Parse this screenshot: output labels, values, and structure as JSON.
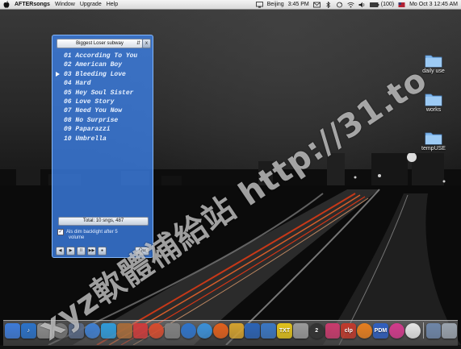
{
  "menubar": {
    "app_name": "AFTERsongs",
    "menus": [
      "Window",
      "Upgrade",
      "Help"
    ],
    "location": "Beijing",
    "clock": "3:45 PM",
    "battery": "(100)",
    "datetime": "Mo Oct 3 12:45 AM"
  },
  "desktop": {
    "icons": [
      {
        "label": "daily use"
      },
      {
        "label": "works"
      },
      {
        "label": "tempUSE"
      }
    ]
  },
  "widget": {
    "playlist_selector": "Biggest Loser subway",
    "close_label": "x",
    "songs": [
      "01 According To You",
      "02 American Boy",
      "03 Bleeding Love",
      "04 Hard",
      "05 Hey Soul Sister",
      "06 Love Story",
      "07 Need You Now",
      "08 No Surprise",
      "09 Paparazzi",
      "10 Umbrella"
    ],
    "total": "Total: 10 sngs, 487",
    "backlight_label": "Als dim backlight after 5",
    "volume_label": "volume",
    "quit_label": "Qu",
    "controls": [
      "◀",
      "▶",
      "II",
      "▶▶",
      "●"
    ]
  },
  "watermark": {
    "text": "xyz軟體補給站 http://31.to"
  },
  "dock": {
    "items": [
      {
        "name": "finder-icon",
        "label": "",
        "color": "#3d7bd8"
      },
      {
        "name": "itunes-icon",
        "label": "♪",
        "color": "#2b72c8"
      },
      {
        "name": "network-icon",
        "label": "",
        "color": "#8a8a8a"
      },
      {
        "name": "compass-icon",
        "label": "",
        "color": "#777777"
      },
      {
        "name": "settings-icon",
        "label": "",
        "color": "#5a6a86"
      },
      {
        "name": "ball-icon",
        "label": "",
        "color": "#3f7fd0"
      },
      {
        "name": "people-icon",
        "label": "",
        "color": "#2f9ad8"
      },
      {
        "name": "photo-icon",
        "label": "",
        "color": "#a56b3a"
      },
      {
        "name": "ical-icon",
        "label": "",
        "color": "#cc3b3b"
      },
      {
        "name": "lifesaver-icon",
        "label": "",
        "color": "#d44b2e"
      },
      {
        "name": "system-prefs-icon",
        "label": "",
        "color": "#808080"
      },
      {
        "name": "safari-icon",
        "label": "",
        "color": "#2e73c9"
      },
      {
        "name": "globe-icon",
        "label": "",
        "color": "#3a8fd6"
      },
      {
        "name": "firefox-icon",
        "label": "",
        "color": "#e0601c"
      },
      {
        "name": "folder-icon",
        "label": "",
        "color": "#d3a12e"
      },
      {
        "name": "xcode-icon",
        "label": "",
        "color": "#2b63b5"
      },
      {
        "name": "ftp-icon",
        "label": "",
        "color": "#3a76c2"
      },
      {
        "name": "txt-icon",
        "label": "TXT",
        "color": "#e2c21b"
      },
      {
        "name": "eye-icon",
        "label": "",
        "color": "#9a9a9a"
      },
      {
        "name": "number-two-icon",
        "label": "2",
        "color": "#333333"
      },
      {
        "name": "cube-icon",
        "label": "",
        "color": "#c93a6d"
      },
      {
        "name": "clipboard-icon",
        "label": "clp",
        "color": "#c0392b"
      },
      {
        "name": "orange-ball-icon",
        "label": "",
        "color": "#e67e1e"
      },
      {
        "name": "pdm-icon",
        "label": "PDM",
        "color": "#2f5fbf"
      },
      {
        "name": "pink-o-icon",
        "label": "",
        "color": "#d23a8c"
      },
      {
        "name": "clock-icon",
        "label": "",
        "color": "#e5e5e5"
      },
      {
        "name": "stacks-icon",
        "label": "",
        "color": "#6e86a8"
      },
      {
        "name": "trash-icon",
        "label": "",
        "color": "#9aa3ad"
      }
    ]
  }
}
